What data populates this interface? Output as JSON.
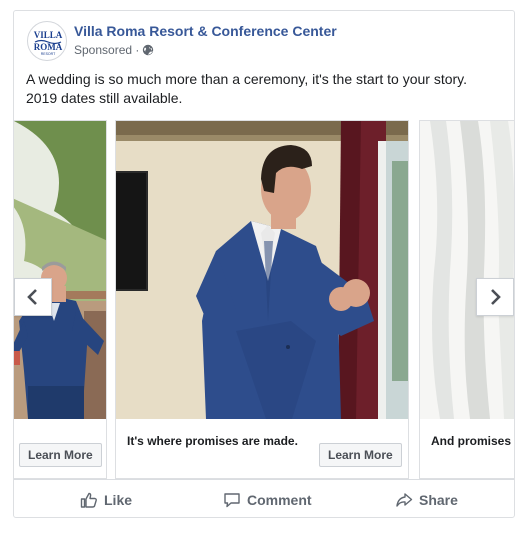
{
  "post": {
    "page_name": "Villa Roma Resort & Conference Center",
    "sponsored_label": "Sponsored ·",
    "caption_lines": [
      "A wedding is so much more than a ceremony, it's the start to your story.",
      "2019 dates still available."
    ]
  },
  "logo": {
    "line1": "VILLA",
    "line2": "ROMA",
    "line3": "RESORT",
    "brand_color": "#1b3f8f"
  },
  "carousel": {
    "cards": [
      {
        "headline": "",
        "cta_label": "Learn More",
        "image": "groom-walking-outdoors"
      },
      {
        "headline": "It's where promises are made.",
        "cta_label": "Learn More",
        "image": "groom-adjusting-cufflinks-by-window"
      },
      {
        "headline": "And promises",
        "cta_label": "",
        "image": "white-curtain"
      }
    ],
    "prev_icon": "chevron-left-icon",
    "next_icon": "chevron-right-icon"
  },
  "actions": {
    "like_label": "Like",
    "comment_label": "Comment",
    "share_label": "Share"
  },
  "colors": {
    "link": "#385898",
    "muted": "#606770",
    "suit": "#2d4d8a"
  }
}
